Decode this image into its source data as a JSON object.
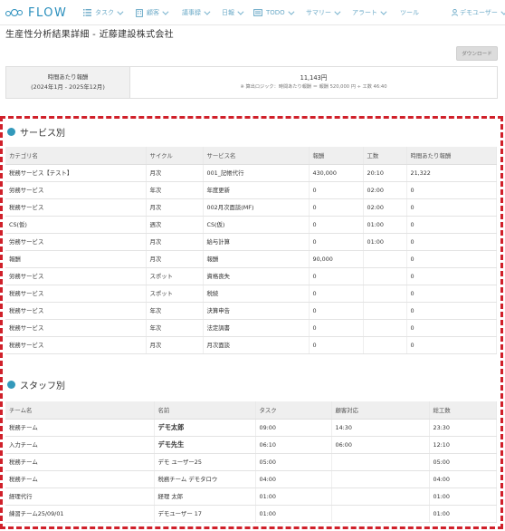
{
  "nav": {
    "logo": "FLOW",
    "items": [
      {
        "label": "タスク",
        "icon": "list-icon"
      },
      {
        "label": "顧客",
        "icon": "building-icon"
      },
      {
        "label": "議事録",
        "icon": ""
      },
      {
        "label": "日報",
        "icon": ""
      },
      {
        "label": "TODO",
        "icon": "todo-icon"
      },
      {
        "label": "サマリー",
        "icon": ""
      },
      {
        "label": "アラート",
        "icon": ""
      },
      {
        "label": "ツール",
        "icon": ""
      }
    ],
    "user": "デモユーザー",
    "accent": "#2a8fbd"
  },
  "page_title": "生産性分析結果詳細 - 近藤建設株式会社",
  "download_label": "ダウンロード",
  "summary": {
    "label_line1": "時間あたり報酬",
    "label_line2": "(2024年1月 - 2025年12月)",
    "value": "11,143円",
    "note": "※ 算出ロジック：時間あたり報酬 ＝ 報酬 520,000 円 ÷ 工数 46:40"
  },
  "service_section": {
    "title": "サービス別",
    "columns": [
      "カテゴリ名",
      "サイクル",
      "サービス名",
      "報酬",
      "工数",
      "時間あたり報酬"
    ],
    "rows": [
      [
        "税務サービス【テスト】",
        "月次",
        "001_記帳代行",
        "430,000",
        "20:10",
        "21,322"
      ],
      [
        "労務サービス",
        "年次",
        "年度更新",
        "0",
        "02:00",
        "0"
      ],
      [
        "税務サービス",
        "月次",
        "002月次面談(MF)",
        "0",
        "02:00",
        "0"
      ],
      [
        "CS(仮)",
        "週次",
        "CS(仮)",
        "0",
        "01:00",
        "0"
      ],
      [
        "労務サービス",
        "月次",
        "給与計算",
        "0",
        "01:00",
        "0"
      ],
      [
        "報酬",
        "月次",
        "報酬",
        "90,000",
        "",
        "0"
      ],
      [
        "労務サービス",
        "スポット",
        "資格喪失",
        "0",
        "",
        "0"
      ],
      [
        "税務サービス",
        "スポット",
        "税続",
        "0",
        "",
        "0"
      ],
      [
        "税務サービス",
        "年次",
        "決算申告",
        "0",
        "",
        "0"
      ],
      [
        "税務サービス",
        "年次",
        "法定調書",
        "0",
        "",
        "0"
      ],
      [
        "税務サービス",
        "月次",
        "月次面談",
        "0",
        "",
        "0"
      ]
    ]
  },
  "staff_section": {
    "title": "スタッフ別",
    "columns": [
      "チーム名",
      "名前",
      "タスク",
      "顧客対応",
      "総工数"
    ],
    "rows": [
      [
        "税務チーム",
        "デモ太郎",
        "09:00",
        "14:30",
        "23:30"
      ],
      [
        "入力チーム",
        "デモ先生",
        "06:10",
        "06:00",
        "12:10"
      ],
      [
        "税務チーム",
        "デモ ユーザー25",
        "05:00",
        "",
        "05:00"
      ],
      [
        "税務チーム",
        "税務チーム デモタロウ",
        "04:00",
        "",
        "04:00"
      ],
      [
        "経理代行",
        "経理 太郎",
        "01:00",
        "",
        "01:00"
      ],
      [
        "練習チーム25/09/01",
        "デモユーザー 17",
        "01:00",
        "",
        "01:00"
      ]
    ]
  }
}
